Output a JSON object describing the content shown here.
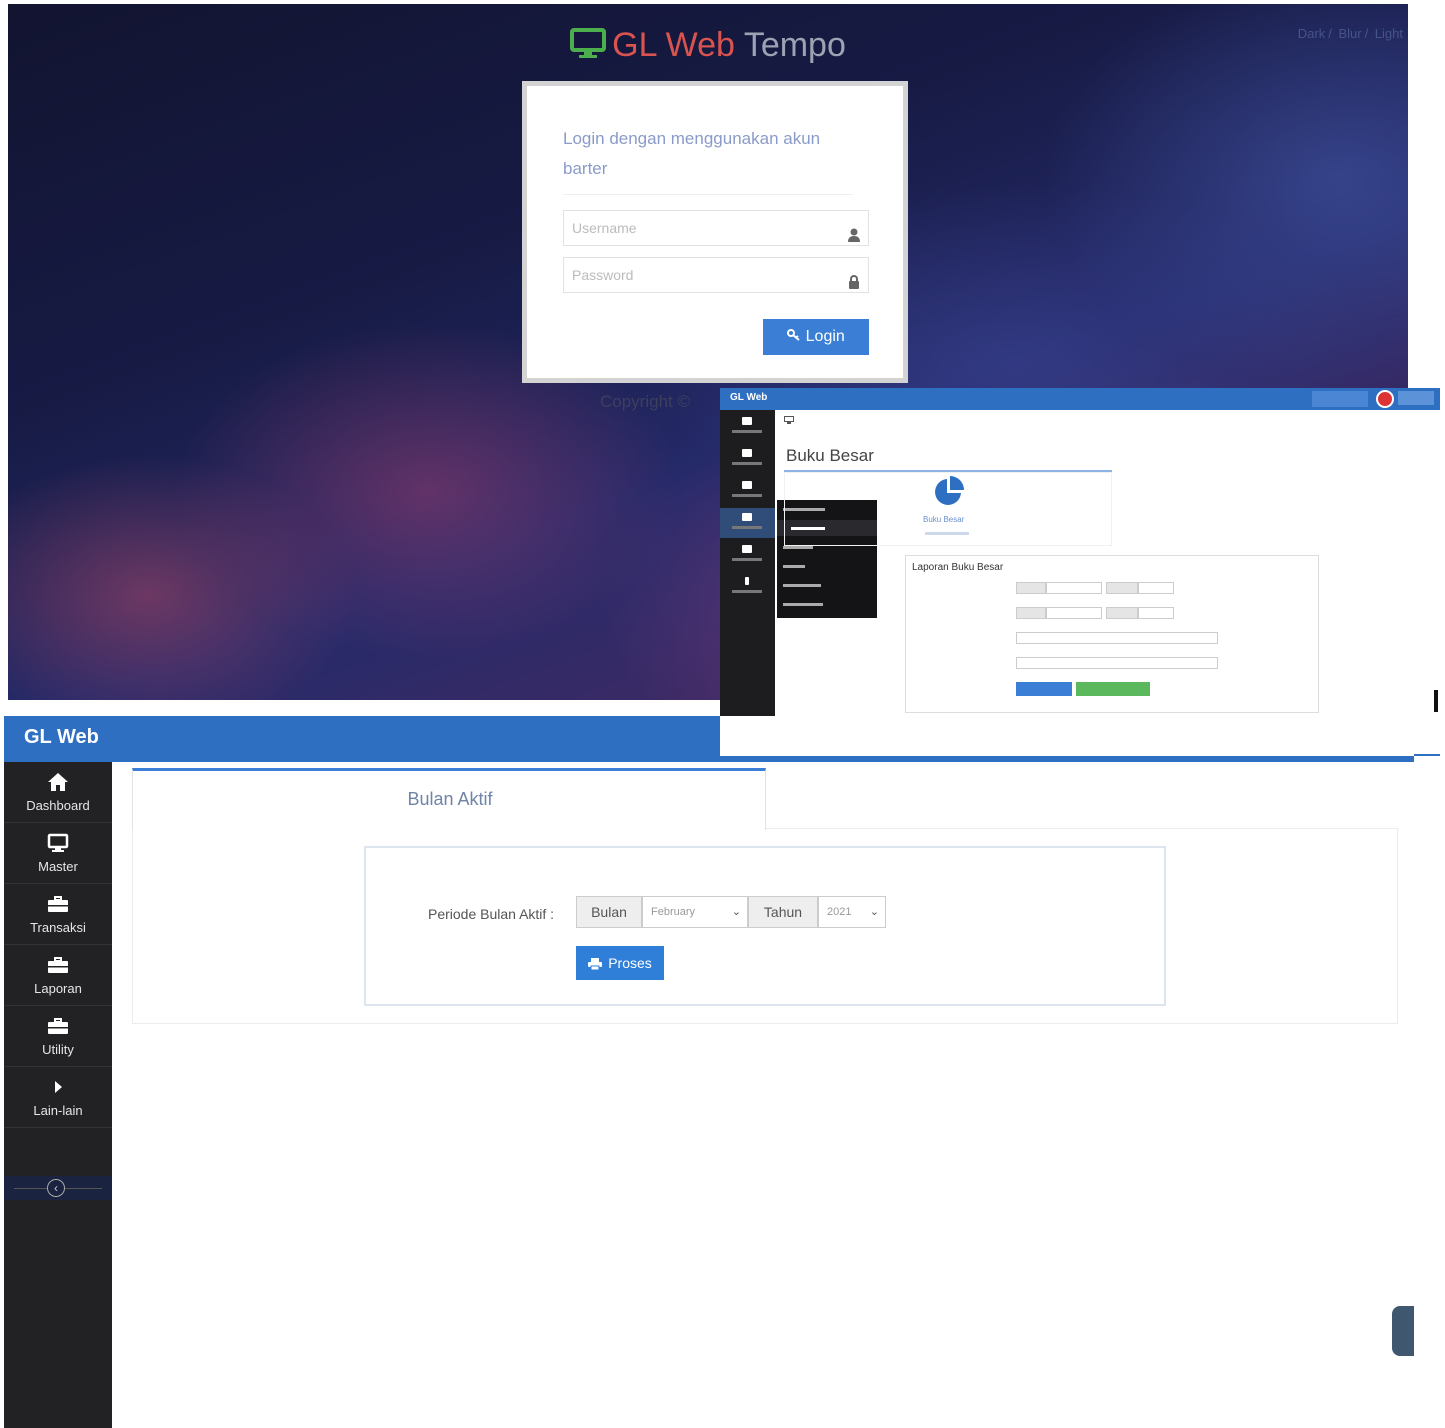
{
  "login": {
    "title_part1": "GL Web",
    "title_part2": "Tempo",
    "theme_links": [
      "Dark",
      "Blur",
      "Light"
    ],
    "heading": "Login dengan menggunakan akun barter",
    "username_placeholder": "Username",
    "password_placeholder": "Password",
    "login_button": "Login",
    "copyright": "Copyright ©",
    "colors": {
      "accent": "#3a7fd5",
      "brand_red": "#d9534f",
      "brand_icon": "#4cae4c"
    }
  },
  "buku_besar": {
    "brand": "GL Web",
    "page_title": "Buku Besar",
    "card_label": "Buku Besar",
    "form_title": "Laporan Buku Besar"
  },
  "bulan_aktif": {
    "brand": "GL Web",
    "sidebar": [
      {
        "label": "Dashboard",
        "icon": "home-icon"
      },
      {
        "label": "Master",
        "icon": "monitor-icon"
      },
      {
        "label": "Transaksi",
        "icon": "briefcase-icon"
      },
      {
        "label": "Laporan",
        "icon": "briefcase-icon"
      },
      {
        "label": "Utility",
        "icon": "briefcase-icon"
      },
      {
        "label": "Lain-lain",
        "icon": "caret-right-icon"
      }
    ],
    "tab_label": "Bulan Aktif",
    "periode_label": "Periode Bulan Aktif :",
    "bulan_addon": "Bulan",
    "bulan_value": "February",
    "tahun_addon": "Tahun",
    "tahun_value": "2021",
    "proses_button": "Proses",
    "colors": {
      "topbar": "#2f6fc2",
      "sidebar": "#222224",
      "button": "#2f7fd8"
    }
  }
}
